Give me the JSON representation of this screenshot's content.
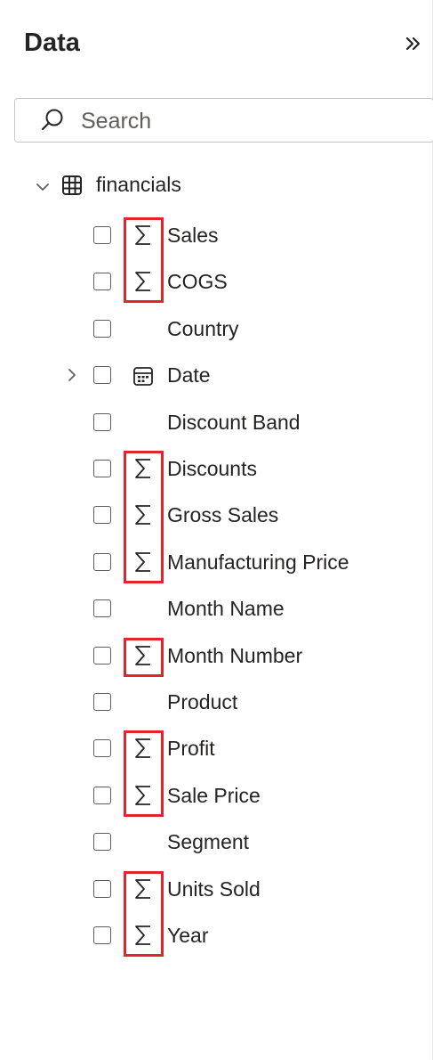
{
  "panel": {
    "title": "Data",
    "collapse_icon": "double-chevron-right-icon"
  },
  "search": {
    "placeholder": "Search",
    "value": ""
  },
  "table": {
    "name": "financials",
    "expanded": true,
    "icon": "table-icon"
  },
  "fields": [
    {
      "label": "Sales",
      "type": "sum",
      "checked": false
    },
    {
      "label": "COGS",
      "type": "sum",
      "checked": false
    },
    {
      "label": "Country",
      "type": "text",
      "checked": false
    },
    {
      "label": "Date",
      "type": "date",
      "checked": false,
      "expandable": true
    },
    {
      "label": "Discount Band",
      "type": "text",
      "checked": false
    },
    {
      "label": "Discounts",
      "type": "sum",
      "checked": false
    },
    {
      "label": "Gross Sales",
      "type": "sum",
      "checked": false
    },
    {
      "label": "Manufacturing Price",
      "type": "sum",
      "checked": false
    },
    {
      "label": "Month Name",
      "type": "text",
      "checked": false
    },
    {
      "label": "Month Number",
      "type": "sum",
      "checked": false
    },
    {
      "label": "Product",
      "type": "text",
      "checked": false
    },
    {
      "label": "Profit",
      "type": "sum",
      "checked": false
    },
    {
      "label": "Sale Price",
      "type": "sum",
      "checked": false
    },
    {
      "label": "Segment",
      "type": "text",
      "checked": false
    },
    {
      "label": "Units Sold",
      "type": "sum",
      "checked": false
    },
    {
      "label": "Year",
      "type": "sum",
      "checked": false
    }
  ],
  "colors": {
    "highlight": "#e3242b",
    "text": "#252423",
    "icon": "#605e5c"
  }
}
